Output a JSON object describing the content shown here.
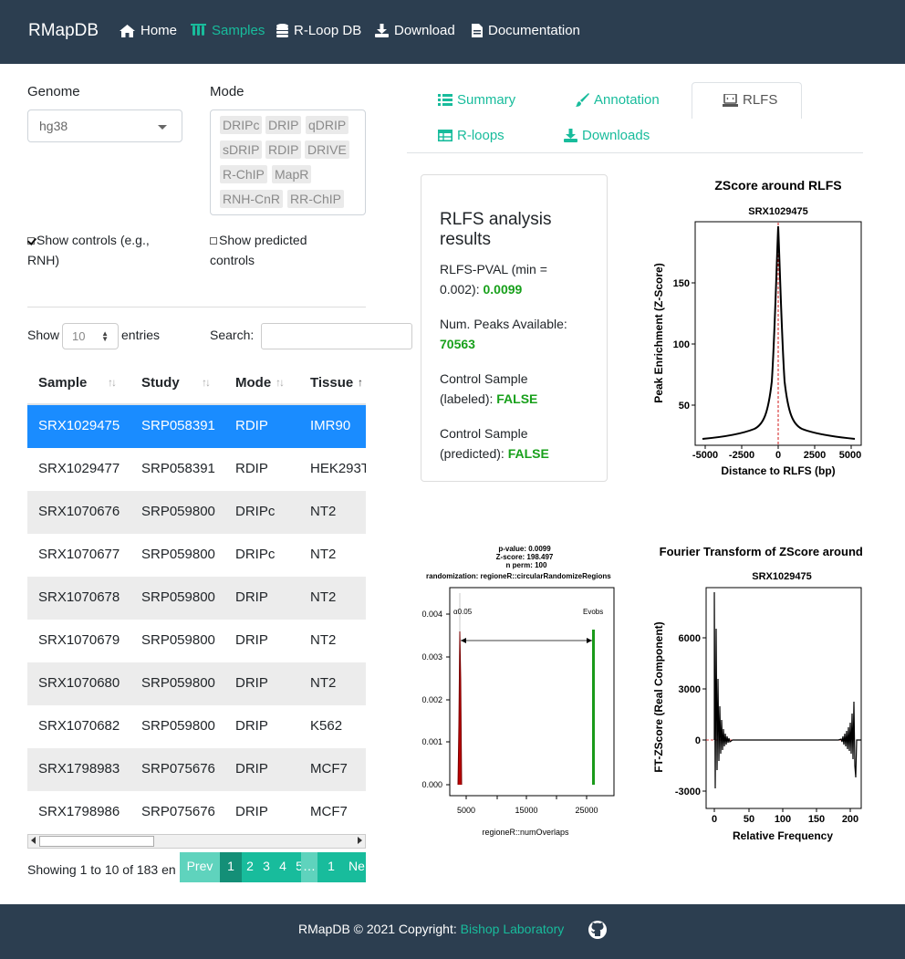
{
  "nav": {
    "brand": "RMapDB",
    "items": [
      {
        "label": "Home",
        "icon": "home-icon",
        "active": false
      },
      {
        "label": "Samples",
        "icon": "flask-icon",
        "active": true
      },
      {
        "label": "R-Loop DB",
        "icon": "database-icon",
        "active": false
      },
      {
        "label": "Download",
        "icon": "download-icon",
        "active": false
      },
      {
        "label": "Documentation",
        "icon": "file-icon",
        "active": false
      }
    ]
  },
  "filters": {
    "genome_label": "Genome",
    "genome_value": "hg38",
    "mode_label": "Mode",
    "modes": [
      "DRIPc",
      "DRIP",
      "qDRIP",
      "sDRIP",
      "RDIP",
      "DRIVE",
      "R-ChIP",
      "MapR",
      "RNH-CnR",
      "RR-ChIP"
    ],
    "show_controls": "Show controls (e.g., RNH)",
    "show_controls_line1": "Show controls (e.g.,",
    "show_controls_line2": "RNH)",
    "show_predicted_line1": "Show predicted",
    "show_predicted_line2": "controls"
  },
  "table_controls": {
    "show": "Show",
    "length_value": "10",
    "entries": "entries",
    "search_label": "Search:"
  },
  "table": {
    "columns": [
      "Sample",
      "Study",
      "Mode",
      "Tissue"
    ],
    "rows": [
      [
        "SRX1029475",
        "SRP058391",
        "RDIP",
        "IMR90"
      ],
      [
        "SRX1029477",
        "SRP058391",
        "RDIP",
        "HEK293T"
      ],
      [
        "SRX1070676",
        "SRP059800",
        "DRIPc",
        "NT2"
      ],
      [
        "SRX1070677",
        "SRP059800",
        "DRIPc",
        "NT2"
      ],
      [
        "SRX1070678",
        "SRP059800",
        "DRIP",
        "NT2"
      ],
      [
        "SRX1070679",
        "SRP059800",
        "DRIP",
        "NT2"
      ],
      [
        "SRX1070680",
        "SRP059800",
        "DRIP",
        "NT2"
      ],
      [
        "SRX1070682",
        "SRP059800",
        "DRIP",
        "K562"
      ],
      [
        "SRX1798983",
        "SRP075676",
        "DRIP",
        "MCF7"
      ],
      [
        "SRX1798986",
        "SRP075676",
        "DRIP",
        "MCF7"
      ]
    ],
    "showing_text": "Showing 1 to 10 of 183 en"
  },
  "pagination": {
    "prev": "Prev",
    "pages": [
      "1",
      "2",
      "3",
      "4",
      "5",
      "…",
      "1"
    ],
    "next": "Ne",
    "current": "1"
  },
  "tabs": [
    {
      "label": "Summary",
      "icon": "list-icon"
    },
    {
      "label": "Annotation",
      "icon": "brush-icon"
    },
    {
      "label": "RLFS",
      "icon": "laptop-icon"
    },
    {
      "label": "R-loops",
      "icon": "table-icon"
    },
    {
      "label": "Downloads",
      "icon": "download-icon"
    }
  ],
  "rlfs_card": {
    "title": "RLFS analysis results",
    "title_line1": "RLFS analysis",
    "title_line2": "results",
    "pval_line1": "RLFS-PVAL (min =",
    "pval_line2": "0.002):",
    "pval_value": "0.0099",
    "peaks_label": "Num. Peaks Available:",
    "peaks_value": "70563",
    "ctrl_labeled_line1": "Control Sample",
    "ctrl_labeled_line2": "(labeled):",
    "ctrl_labeled_value": "FALSE",
    "ctrl_pred_line1": "Control Sample",
    "ctrl_pred_line2": "(predicted):",
    "ctrl_pred_value": "FALSE"
  },
  "plot_zscore": {
    "title": "ZScore around RLFS",
    "subtitle": "SRX1029475",
    "xlabel": "Distance to RLFS (bp)",
    "ylabel": "Peak Enrichment (Z-Score)",
    "xticks": [
      "-5000",
      "-2500",
      "0",
      "2500",
      "5000"
    ],
    "yticks": [
      "50",
      "100",
      "150"
    ]
  },
  "plot_perm": {
    "line1": "p-value:  0.0099",
    "line2": "Z-score:  198.497",
    "line3": "n perm:  100",
    "line4": "randomization:  regioneR::circularRandomizeRegions",
    "xlabel": "regioneR::numOverlaps",
    "xticks": [
      "5000",
      "15000",
      "25000"
    ],
    "yticks": [
      "0.000",
      "0.001",
      "0.002",
      "0.003",
      "0.004"
    ],
    "label_alpha": "α0.05",
    "label_ev": "Evobs"
  },
  "plot_fourier": {
    "title": "Fourier Transform of ZScore around RLFS",
    "subtitle": "SRX1029475",
    "xlabel": "Relative Frequency",
    "ylabel": "FT-ZScore (Real Component)",
    "xticks": [
      "0",
      "50",
      "100",
      "150",
      "200"
    ],
    "yticks": [
      "-3000",
      "0",
      "3000",
      "6000"
    ]
  },
  "footer": {
    "text": "RMapDB © 2021 Copyright:",
    "link": "Bishop Laboratory"
  },
  "colors": {
    "navbar": "#2c3e50",
    "accent": "#18bc9c",
    "selected_row": "#1a8cff",
    "value_green": "#18a01b"
  }
}
